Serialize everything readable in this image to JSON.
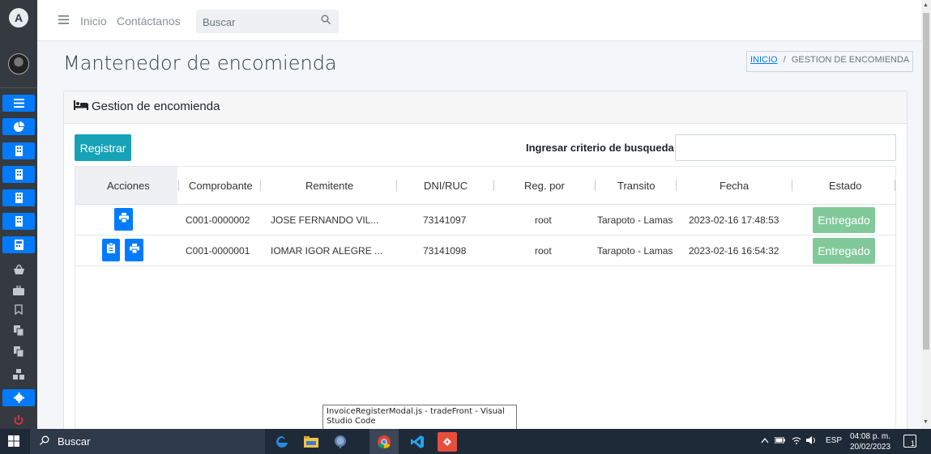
{
  "navbar": {
    "links": [
      "Inicio",
      "Contáctanos"
    ],
    "search_placeholder": "Buscar"
  },
  "page": {
    "title": "Mantenedor de encomienda",
    "breadcrumb_home": "INICIO",
    "breadcrumb_sep": "/",
    "breadcrumb_current": "GESTION DE ENCOMIENDA"
  },
  "card": {
    "title": "Gestion de encomienda",
    "register_label": "Registrar",
    "search_label": "Ingresar criterio de busqueda:",
    "search_value": ""
  },
  "table": {
    "headers": [
      "Acciones",
      "Comprobante",
      "Remitente",
      "DNI/RUC",
      "Reg. por",
      "Transito",
      "Fecha",
      "Estado"
    ],
    "rows": [
      {
        "comprobante": "C001-0000002",
        "remitente": "JOSE FERNANDO VIL...",
        "dni": "73141097",
        "reg_por": "root",
        "transito": "Tarapoto - Lamas",
        "fecha": "2023-02-16 17:48:53",
        "estado": "Entregado"
      },
      {
        "comprobante": "C001-0000001",
        "remitente": "IOMAR IGOR ALEGRE ...",
        "dni": "73141098",
        "reg_por": "root",
        "transito": "Tarapoto - Lamas",
        "fecha": "2023-02-16 16:54:32",
        "estado": "Entregado"
      }
    ]
  },
  "tooltip": {
    "text": "InvoiceRegisterModal.js - tradeFront - Visual Studio Code"
  },
  "taskbar": {
    "search_label": "Buscar",
    "language": "ESP",
    "time": "04:08 p. m.",
    "date": "20/02/2023",
    "notification_count": "1"
  },
  "colors": {
    "sidebar": "#343a40",
    "primary": "#007bff",
    "info": "#17a2b8",
    "success_badge": "#82c99a",
    "taskbar": "#1f2a38"
  }
}
